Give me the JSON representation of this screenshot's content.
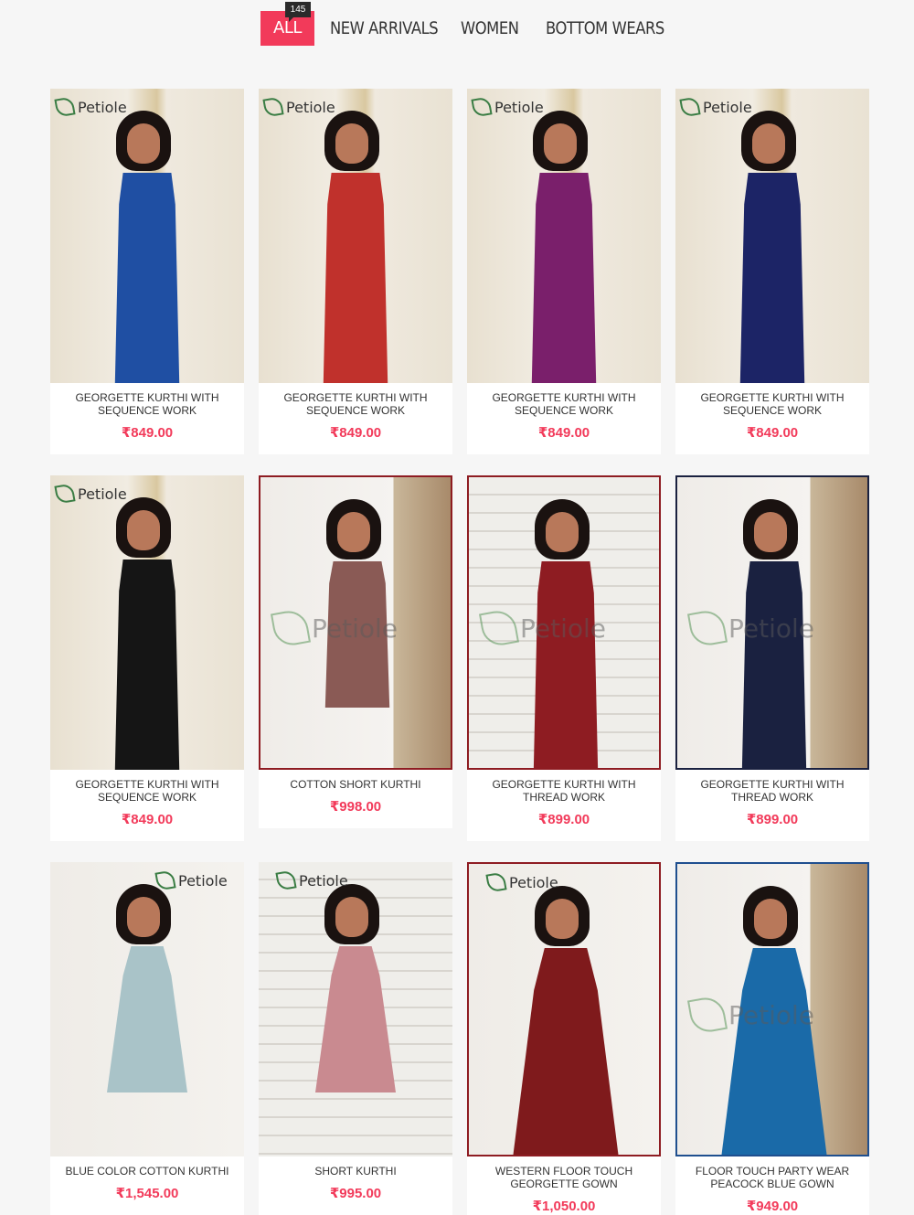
{
  "filters": {
    "tabs": [
      {
        "label": "ALL",
        "active": true
      },
      {
        "label": "NEW ARRIVALS",
        "active": false
      },
      {
        "label": "WOMEN",
        "active": false
      },
      {
        "label": "BOTTOM WEARS",
        "active": false
      }
    ],
    "count_badge": "145"
  },
  "brand": {
    "logo_text": "Petiole"
  },
  "colors": {
    "accent": "#f23a5a"
  },
  "products": [
    {
      "name": "GEORGETTE KURTHI WITH SEQUENCE WORK",
      "price": "₹849.00",
      "dress_color": "#1f4fa3"
    },
    {
      "name": "GEORGETTE KURTHI WITH SEQUENCE WORK",
      "price": "₹849.00",
      "dress_color": "#c0312c"
    },
    {
      "name": "GEORGETTE KURTHI WITH SEQUENCE WORK",
      "price": "₹849.00",
      "dress_color": "#7a1f6b"
    },
    {
      "name": "GEORGETTE KURTHI WITH SEQUENCE WORK",
      "price": "₹849.00",
      "dress_color": "#1c2466"
    },
    {
      "name": "GEORGETTE KURTHI WITH SEQUENCE WORK",
      "price": "₹849.00",
      "dress_color": "#151515"
    },
    {
      "name": "COTTON SHORT KURTHI",
      "price": "₹998.00",
      "dress_color": "#8a5a55"
    },
    {
      "name": "GEORGETTE KURTHI WITH THREAD WORK",
      "price": "₹899.00",
      "dress_color": "#8e1c22"
    },
    {
      "name": "GEORGETTE KURTHI WITH THREAD WORK",
      "price": "₹899.00",
      "dress_color": "#1a2140"
    },
    {
      "name": "BLUE COLOR COTTON KURTHI",
      "price": "₹1,545.00",
      "dress_color": "#a9c3c8"
    },
    {
      "name": "SHORT KURTHI",
      "price": "₹995.00",
      "dress_color": "#c98a90"
    },
    {
      "name": "WESTERN FLOOR TOUCH GEORGETTE GOWN",
      "price": "₹1,050.00",
      "dress_color": "#7f1a1c"
    },
    {
      "name": "FLOOR TOUCH PARTY WEAR PEACOCK BLUE GOWN",
      "price": "₹949.00",
      "dress_color": "#1a6aa8"
    }
  ]
}
